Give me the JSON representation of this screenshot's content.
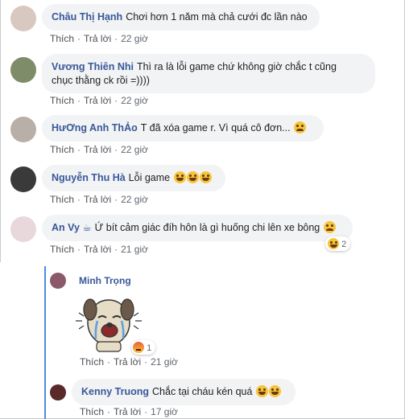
{
  "comments": [
    {
      "name": "Châu Thị Hạnh",
      "text": "Chơi hơn 1 năm mà chả cưới đc lần nào",
      "like": "Thích",
      "reply": "Trả lời",
      "time": "22 giờ",
      "avatar_color": "#d9c8c0"
    },
    {
      "name": "Vương Thiên Nhi",
      "text_line1": "Thì ra là lỗi game chứ không giờ chắc t cũng",
      "text_line2": "chục thằng ck rồi =))))",
      "like": "Thích",
      "reply": "Trả lời",
      "time": "22 giờ",
      "avatar_color": "#7f8c6a"
    },
    {
      "name": "HưƠng Anh ThẢo",
      "text": "T đã xóa game r. Vì quá cô đơn...",
      "like": "Thích",
      "reply": "Trả lời",
      "time": "22 giờ",
      "avatar_color": "#b8b0a8"
    },
    {
      "name": "Nguyễn Thu Hà",
      "text": "Lỗi game",
      "like": "Thích",
      "reply": "Trả lời",
      "time": "22 giờ",
      "avatar_color": "#3a3a3a"
    },
    {
      "name": "An Vy ☕",
      "text": "Ứ bít cảm giác đíh hôn là gì huống chi lên xe bông",
      "like": "Thích",
      "reply": "Trả lời",
      "time": "21 giờ",
      "reaction_count": "2",
      "avatar_color": "#e8d8dc"
    }
  ],
  "replies": [
    {
      "name": "Minh Trọng",
      "like": "Thích",
      "reply": "Trả lời",
      "time": "21 giờ",
      "reaction_count": "1",
      "avatar_color": "#8a5a6a"
    },
    {
      "name": "Kenny Truong",
      "text": "Chắc tại cháu kén quá",
      "like": "Thích",
      "reply": "Trả lời",
      "time": "17 giờ",
      "avatar_color": "#5a2a2a"
    }
  ],
  "colors": {
    "name_link": "#385898",
    "bubble_bg": "#f2f3f5",
    "meta_text": "#606770",
    "reply_line": "#4e8ae6"
  }
}
